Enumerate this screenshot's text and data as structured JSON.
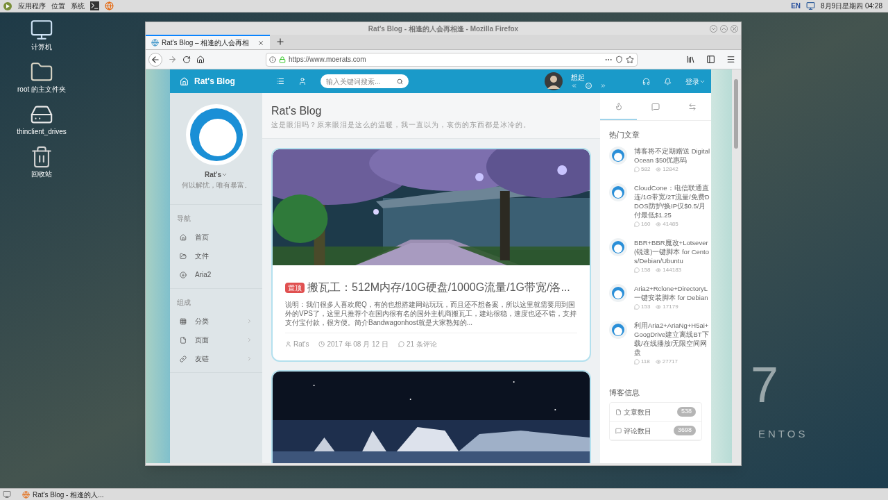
{
  "top_panel": {
    "menus": [
      "应用程序",
      "位置",
      "系统"
    ],
    "input_method": "EN",
    "clock": "8月9日星期四 04:28"
  },
  "desktop_icons": [
    {
      "kind": "computer",
      "label": "计算机"
    },
    {
      "kind": "home",
      "label": "root 的主文件夹"
    },
    {
      "kind": "drive",
      "label": "thinclient_drives"
    },
    {
      "kind": "trash",
      "label": "回收站"
    }
  ],
  "desktop_brand": {
    "number": "7",
    "text": "ENTOS"
  },
  "window": {
    "title": "Rat's Blog - 相逢的人会再相逢 - Mozilla Firefox"
  },
  "tabs": [
    {
      "label": "Rat's Blog – 相逢的人会再相",
      "selected": true
    }
  ],
  "url": "https://www.moerats.com",
  "site": {
    "brand": "Rat's Blog",
    "search_placeholder": "输入关键词搜索...",
    "song": "想起",
    "login": "登录"
  },
  "profile": {
    "name": "Rat's",
    "motto": "何以解忧，唯有暴富。"
  },
  "nav_sections": [
    {
      "heading": "导航",
      "items": [
        {
          "label": "首页",
          "submenu": false
        },
        {
          "label": "文件",
          "submenu": false
        },
        {
          "label": "Aria2",
          "submenu": false
        }
      ]
    },
    {
      "heading": "组成",
      "items": [
        {
          "label": "分类",
          "submenu": true
        },
        {
          "label": "页面",
          "submenu": true
        },
        {
          "label": "友链",
          "submenu": true
        }
      ]
    }
  ],
  "page_header": {
    "title": "Rat's Blog",
    "subtitle": "这是眼泪吗？原来眼泪是这么的温暖，我一直以为，哀伤的东西都是冰冷的。"
  },
  "posts": [
    {
      "kind": "full",
      "badge": "置顶",
      "title": "搬瓦工：512M内存/10G硬盘/1000G流量/1G带宽/洛...",
      "excerpt": "说明：我们很多人喜欢爬Q，有的也想搭建网站玩玩，而且还不想备案，所以这里就需要用到国外的VPS了，这里只推荐个在国内很有名的国外主机商搬瓦工，建站很稳，速度也还不错，支持支付宝付款，很方便。简介Bandwagonhost就是大家熟知的...",
      "author": "Rat's",
      "date": "2017 年 08 月 12 日",
      "comments": "21 条评论"
    },
    {
      "kind": "image_only"
    }
  ],
  "side_tabs": [
    {
      "selected": true
    },
    {
      "selected": false
    },
    {
      "selected": false
    }
  ],
  "hot_articles": {
    "heading": "热门文章",
    "items": [
      {
        "title": "博客将不定期赠送 DigitalOcean $50优惠码",
        "comments": "582",
        "views": "12842"
      },
      {
        "title": "CloudCone：电信联通直连/1G带宽/2T流量/免费DDOS防护/换IP仅$0.5/月付最低$1.25",
        "comments": "160",
        "views": "41485"
      },
      {
        "title": "BBR+BBR魔改+Lotsever(锐速)一键脚本 for Centos/Debian/Ubuntu",
        "comments": "158",
        "views": "144183"
      },
      {
        "title": "Aria2+Rclone+DirectoryL一键安装脚本 for Debian",
        "comments": "153",
        "views": "17179"
      },
      {
        "title": "利用Aria2+AriaNg+H5ai+GoogDrive建立离线BT下载/在线播放/无限空间网盘",
        "comments": "118",
        "views": "27717"
      }
    ]
  },
  "blog_info": {
    "heading": "博客信息",
    "items": [
      {
        "label": "文章数目",
        "count": "538"
      },
      {
        "label": "评论数目",
        "count": "3698"
      }
    ]
  },
  "taskbar": {
    "items": [
      {
        "label": "Rat's Blog - 相逢的人..."
      }
    ]
  }
}
